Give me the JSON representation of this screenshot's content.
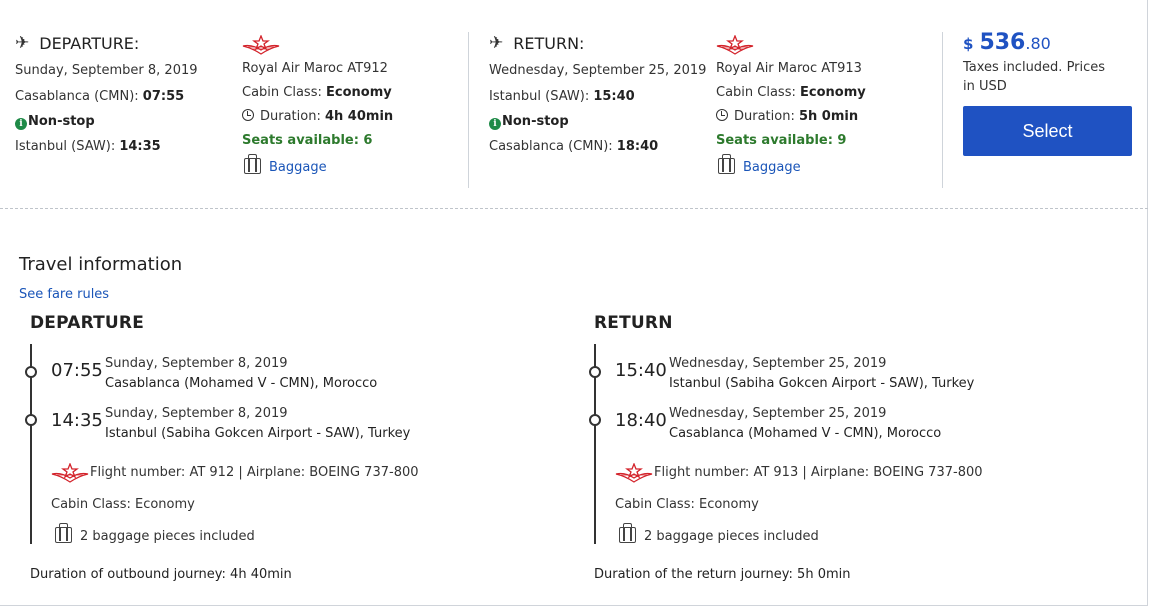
{
  "summary": {
    "departure": {
      "header": "DEPARTURE:",
      "date": "Sunday, September 8, 2019",
      "from_label": "Casablanca (CMN):",
      "from_time": "07:55",
      "stops": "Non-stop",
      "to_label": "Istanbul (SAW):",
      "to_time": "14:35",
      "airline": "Royal Air Maroc AT912",
      "cabin_label": "Cabin Class:",
      "cabin_value": "Economy",
      "duration_label": "Duration:",
      "duration_value": "4h 40min",
      "seats": "Seats available: 6",
      "baggage": "Baggage"
    },
    "return": {
      "header": "RETURN:",
      "date": "Wednesday, September 25, 2019",
      "from_label": "Istanbul (SAW):",
      "from_time": "15:40",
      "stops": "Non-stop",
      "to_label": "Casablanca (CMN):",
      "to_time": "18:40",
      "airline": "Royal Air Maroc AT913",
      "cabin_label": "Cabin Class:",
      "cabin_value": "Economy",
      "duration_label": "Duration:",
      "duration_value": "5h 0min",
      "seats": "Seats available: 9",
      "baggage": "Baggage"
    },
    "price": {
      "currency_symbol": "$",
      "amount_main": "536",
      "amount_cents": ".80",
      "note_line1": "Taxes included. Prices",
      "note_line2": "in USD",
      "select_label": "Select"
    }
  },
  "travel_info": {
    "title": "Travel information",
    "fare_rules_link": "See fare rules",
    "departure": {
      "title": "DEPARTURE",
      "stops": [
        {
          "time": "07:55",
          "date": "Sunday, September 8, 2019",
          "place": "Casablanca (Mohamed V - CMN), Morocco"
        },
        {
          "time": "14:35",
          "date": "Sunday, September 8, 2019",
          "place": "Istanbul (Sabiha Gokcen Airport - SAW), Turkey"
        }
      ],
      "flight_info": "Flight number: AT 912 | Airplane: BOEING 737-800",
      "cabin": "Cabin Class: Economy",
      "baggage": "2 baggage pieces included",
      "duration_label": "Duration of outbound journey:",
      "duration_value": "4h 40min"
    },
    "return": {
      "title": "RETURN",
      "stops": [
        {
          "time": "15:40",
          "date": "Wednesday, September 25, 2019",
          "place": "Istanbul (Sabiha Gokcen Airport - SAW), Turkey"
        },
        {
          "time": "18:40",
          "date": "Wednesday, September 25, 2019",
          "place": "Casablanca (Mohamed V - CMN), Morocco"
        }
      ],
      "flight_info": "Flight number: AT 913 | Airplane: BOEING 737-800",
      "cabin": "Cabin Class: Economy",
      "baggage": "2 baggage pieces included",
      "duration_label": "Duration of the return journey:",
      "duration_value": "5h 0min"
    }
  },
  "colors": {
    "accent": "#1f52c2",
    "link": "#1a55b8",
    "seats_green": "#2d7a2d",
    "logo_red": "#d3222a"
  },
  "icons": [
    "airplane-icon",
    "royal-air-maroc-logo",
    "info-circle-icon",
    "clock-icon",
    "baggage-icon",
    "timeline-dot-icon"
  ]
}
